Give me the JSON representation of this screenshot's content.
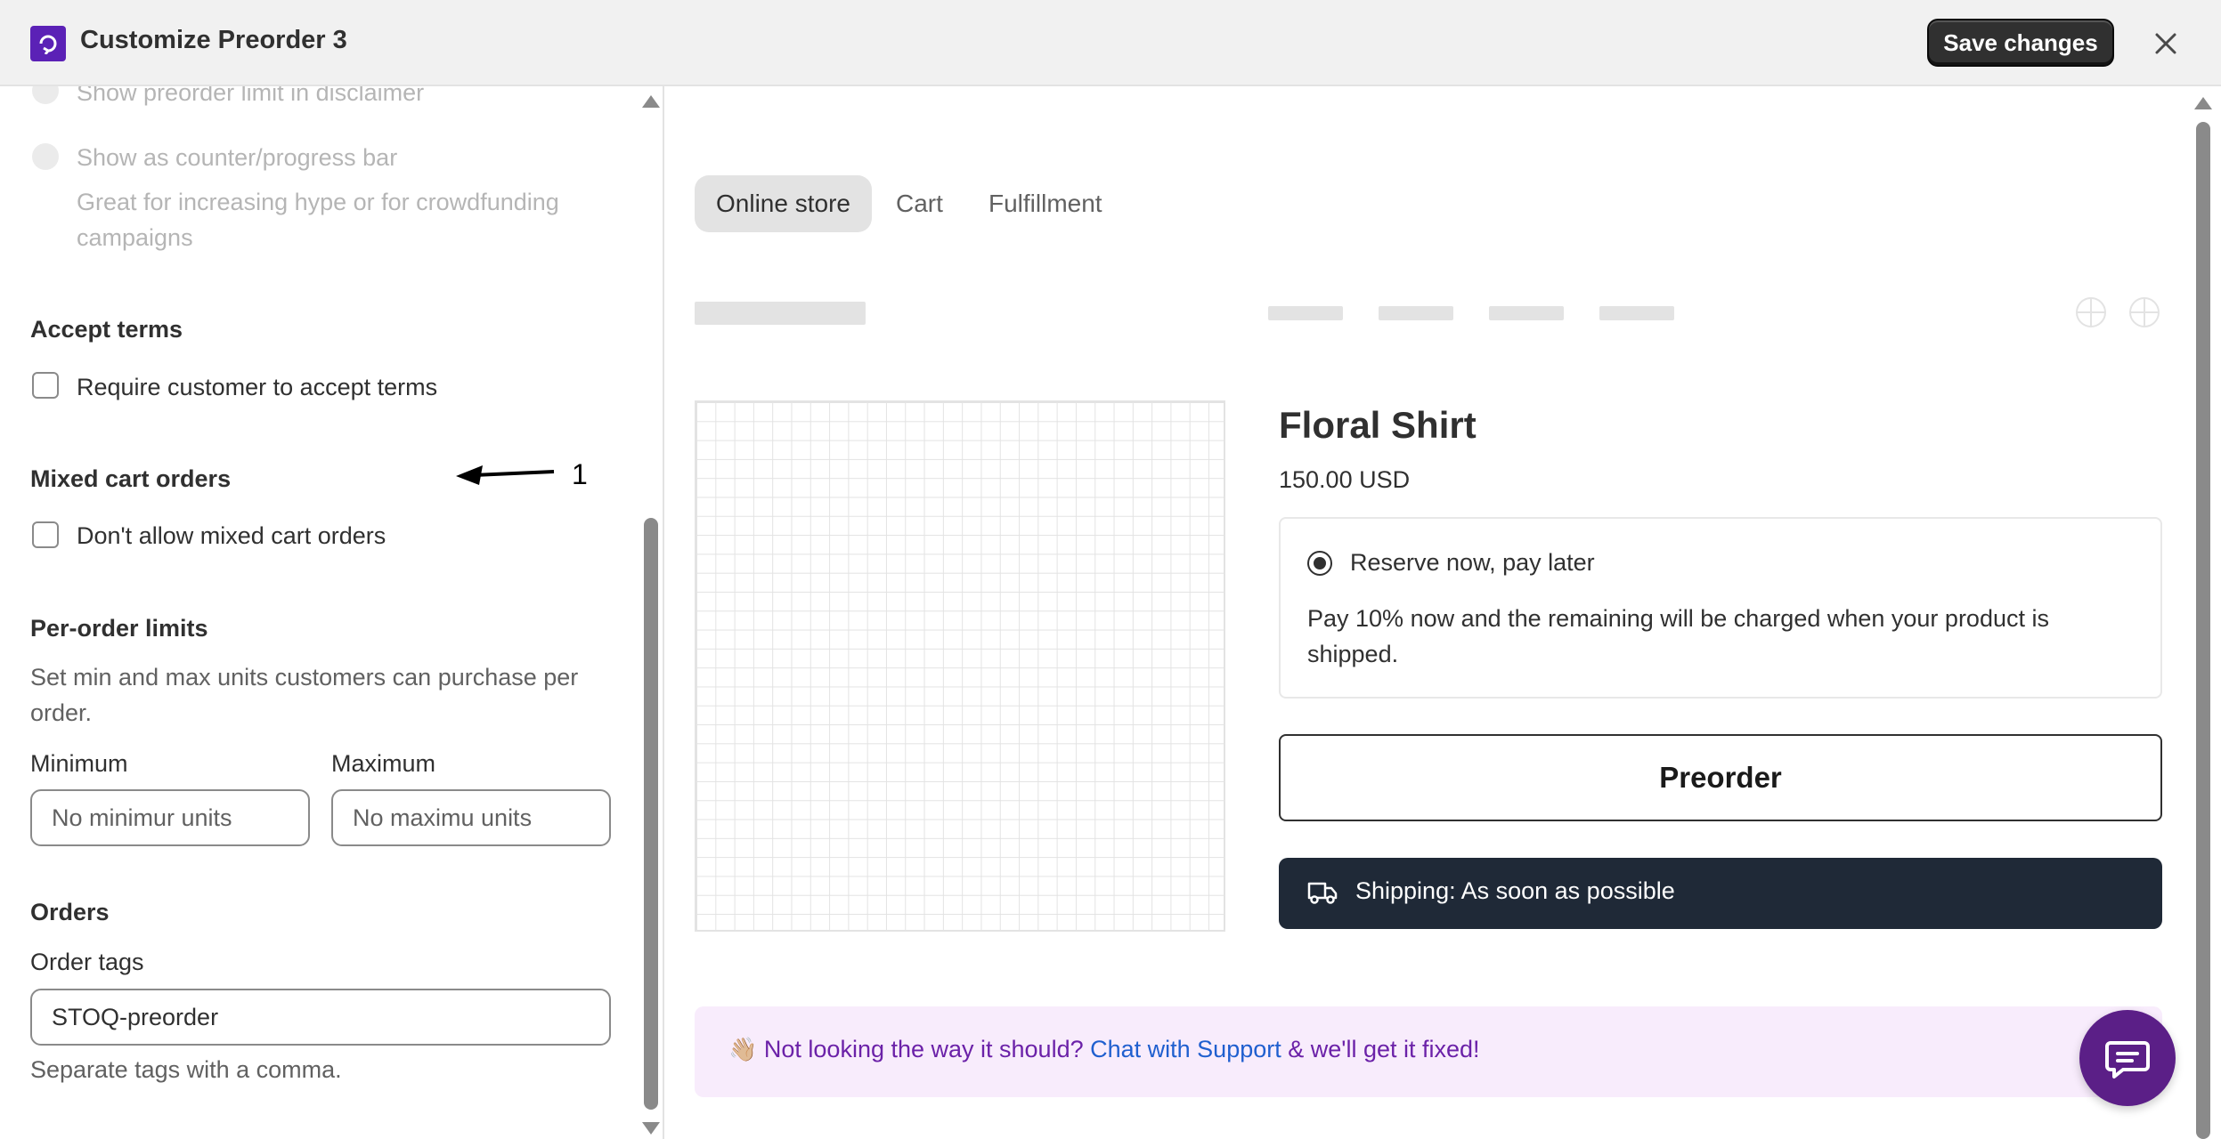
{
  "header": {
    "title": "Customize Preorder 3",
    "save_label": "Save changes",
    "logo_color": "#5b21b6"
  },
  "settings": {
    "limit_disclaimer_label": "Show preorder limit in disclaimer",
    "counter_label": "Show as counter/progress bar",
    "counter_help": "Great for increasing hype or for crowdfunding campaigns",
    "accept_terms": {
      "title": "Accept terms",
      "checkbox_label": "Require customer to accept terms",
      "checked": false
    },
    "mixed_cart": {
      "title": "Mixed cart orders",
      "checkbox_label": "Don't allow mixed cart orders",
      "checked": false
    },
    "per_order_limits": {
      "title": "Per-order limits",
      "description": "Set min and max units customers can purchase per order.",
      "min_label": "Minimum",
      "min_placeholder": "No minimur units",
      "max_label": "Maximum",
      "max_placeholder": "No maximu units"
    },
    "orders": {
      "title": "Orders",
      "tags_label": "Order tags",
      "tags_value": "STOQ-preorder",
      "tags_help": "Separate tags with a comma."
    }
  },
  "annotation": {
    "number": "1"
  },
  "preview": {
    "tabs": [
      {
        "label": "Online store",
        "active": true
      },
      {
        "label": "Cart",
        "active": false
      },
      {
        "label": "Fulfillment",
        "active": false
      }
    ],
    "product": {
      "title": "Floral Shirt",
      "price": "150.00 USD",
      "option_label": "Reserve now, pay later",
      "option_description": "Pay 10% now and the remaining will be charged when your product is shipped.",
      "preorder_label": "Preorder",
      "shipping_text": "Shipping: As soon as possible"
    },
    "support": {
      "emoji": "👋🏼",
      "prefix": "Not looking the way it should?",
      "link": "Chat with Support",
      "suffix": "& we'll get it fixed!"
    }
  },
  "icons": {
    "logo": "app-logo-icon",
    "close": "close-icon",
    "globe": "globe-icon",
    "truck": "truck-icon",
    "chat": "chat-icon",
    "arrow": "arrow-annotation-icon"
  }
}
